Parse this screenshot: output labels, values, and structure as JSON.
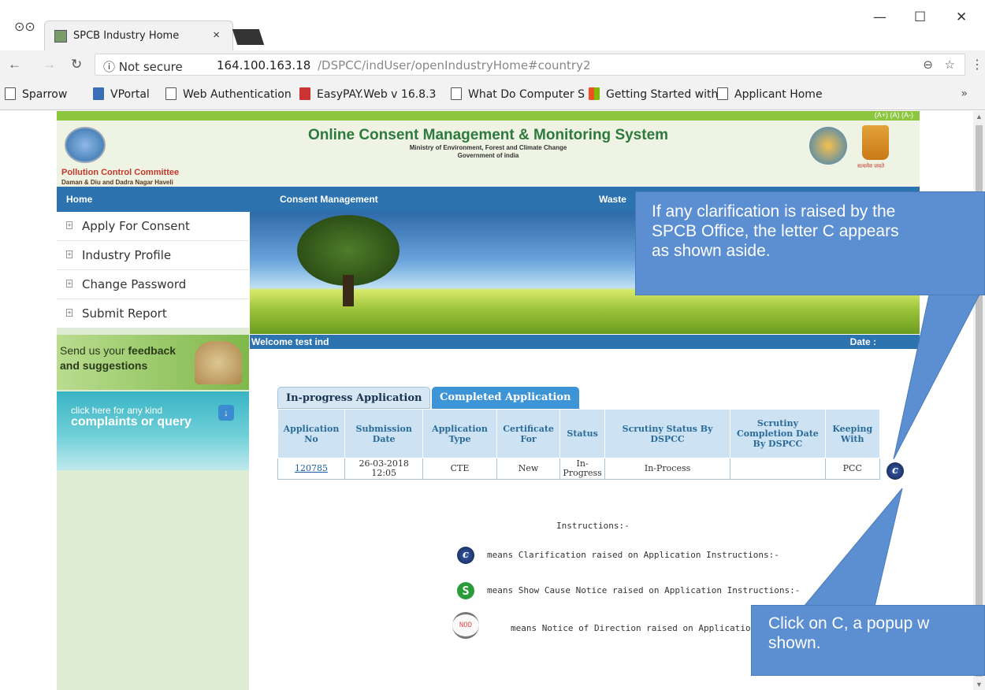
{
  "browser": {
    "tab_title": "SPCB Industry Home",
    "tab_close": "×",
    "window_controls": {
      "minimize": "—",
      "maximize": "☐",
      "close": "✕"
    },
    "secure_label": "ⓘ Not secure",
    "url_host": "164.100.163.18",
    "url_path": "/DSPCC/indUser/openIndustryHome#country2",
    "bookmarks": [
      "Sparrow",
      "VPortal",
      "Web Authentication",
      "EasyPAY.Web v 16.8.3",
      "What Do Computer S",
      "Getting Started with",
      "Applicant Home"
    ],
    "bookmarks_more": "»"
  },
  "site": {
    "font_controls": "(A+) (A) (A-)",
    "org_name": "Pollution Control Committee",
    "org_sub": "Daman & Diu and Dadra Nagar Haveli",
    "system_title": "Online Consent Management & Monitoring System",
    "ministry": "Ministry of Environment, Forest and Climate Change",
    "government": "Government of india",
    "emblem_motto": "सत्यमेव जयते"
  },
  "nav": {
    "home": "Home",
    "consent": "Consent Management",
    "waste": "Waste"
  },
  "sidebar": {
    "items": [
      "Apply For Consent",
      "Industry Profile",
      "Change Password",
      "Submit Report"
    ],
    "feedback_line1": "Send us your",
    "feedback_bold1": "feedback",
    "feedback_line2": "and suggestions",
    "complaints_line1": "click here for any kind",
    "complaints_line2": "complaints or query",
    "complaints_btn": "↓"
  },
  "welcome": {
    "text": "Welcome test ind",
    "date_label": "Date :"
  },
  "tabs": {
    "in_progress": "In-progress Application",
    "completed": "Completed Application"
  },
  "table": {
    "headers": [
      "Application No",
      "Submission Date",
      "Application Type",
      "Certificate For",
      "Status",
      "Scrutiny Status By DSPCC",
      "Scrutiny Completion Date By DSPCC",
      "Keeping With"
    ],
    "rows": [
      {
        "app_no": "120785",
        "date": "26-03-2018 12:05",
        "type": "CTE",
        "cert": "New",
        "status": "In-Progress",
        "scrutiny": "In-Process",
        "completion": "",
        "keeping": "PCC"
      }
    ],
    "clarification_badge": "c"
  },
  "instructions": {
    "title": "Instructions:-",
    "c_text": "means Clarification raised on Application Instructions:-",
    "s_text": "means Show Cause Notice raised on Application Instructions:-",
    "nod_text": "means Notice of Direction raised on Application",
    "c_glyph": "c",
    "s_glyph": "S",
    "nod_glyph": "NOD"
  },
  "callouts": {
    "top": [
      "If any clarification is raised by the",
      "SPCB Office, the letter C appears",
      "as shown aside."
    ],
    "bottom": [
      "Click on C, a popup w",
      "shown."
    ]
  },
  "colors": {
    "callout": "#5b8fd1",
    "nav": "#2c73b0",
    "green": "#8cc63f"
  }
}
